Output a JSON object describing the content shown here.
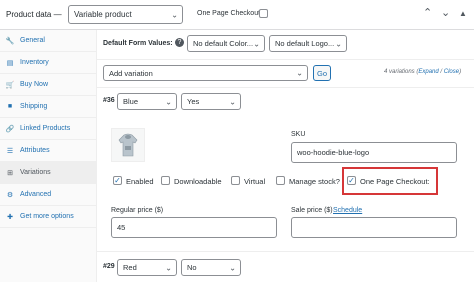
{
  "header": {
    "label": "Product data —",
    "product_type": "Variable product",
    "one_page_checkout_label": "One Page Checkout:",
    "icons": [
      "chevron-up-icon",
      "chevron-down-icon",
      "triangle-up-icon"
    ]
  },
  "sidebar": {
    "items": [
      {
        "label": "General",
        "icon": "wrench-icon"
      },
      {
        "label": "Inventory",
        "icon": "clipboard-icon"
      },
      {
        "label": "Buy Now",
        "icon": "cart-icon"
      },
      {
        "label": "Shipping",
        "icon": "truck-icon"
      },
      {
        "label": "Linked Products",
        "icon": "link-icon"
      },
      {
        "label": "Attributes",
        "icon": "list-icon"
      },
      {
        "label": "Variations",
        "icon": "grid-icon"
      },
      {
        "label": "Advanced",
        "icon": "gear-icon"
      },
      {
        "label": "Get more options",
        "icon": "plugin-icon"
      }
    ],
    "active": "Variations"
  },
  "defaults": {
    "label": "Default Form Values:",
    "color": "No default Color...",
    "logo": "No default Logo..."
  },
  "add_variation": {
    "select": "Add variation",
    "go": "Go",
    "count": "4 variations",
    "expand": "Expand",
    "separator": "/",
    "close": "Close",
    "open_paren": "(",
    "close_paren": ")"
  },
  "variation1": {
    "id": "#36",
    "color": "Blue",
    "logo": "Yes",
    "sku_label": "SKU",
    "sku_value": "woo-hoodie-blue-logo",
    "enabled": "Enabled",
    "downloadable": "Downloadable",
    "virtual": "Virtual",
    "manage_stock": "Manage stock?",
    "one_page_checkout": "One Page Checkout:",
    "regular_price_label": "Regular price ($)",
    "regular_price": "45",
    "sale_price_label": "Sale price ($)",
    "schedule": "Schedule"
  },
  "variation2": {
    "id": "#29",
    "color": "Red",
    "logo": "No"
  },
  "colors": {
    "accent": "#2271b1",
    "highlight": "#d63638"
  }
}
